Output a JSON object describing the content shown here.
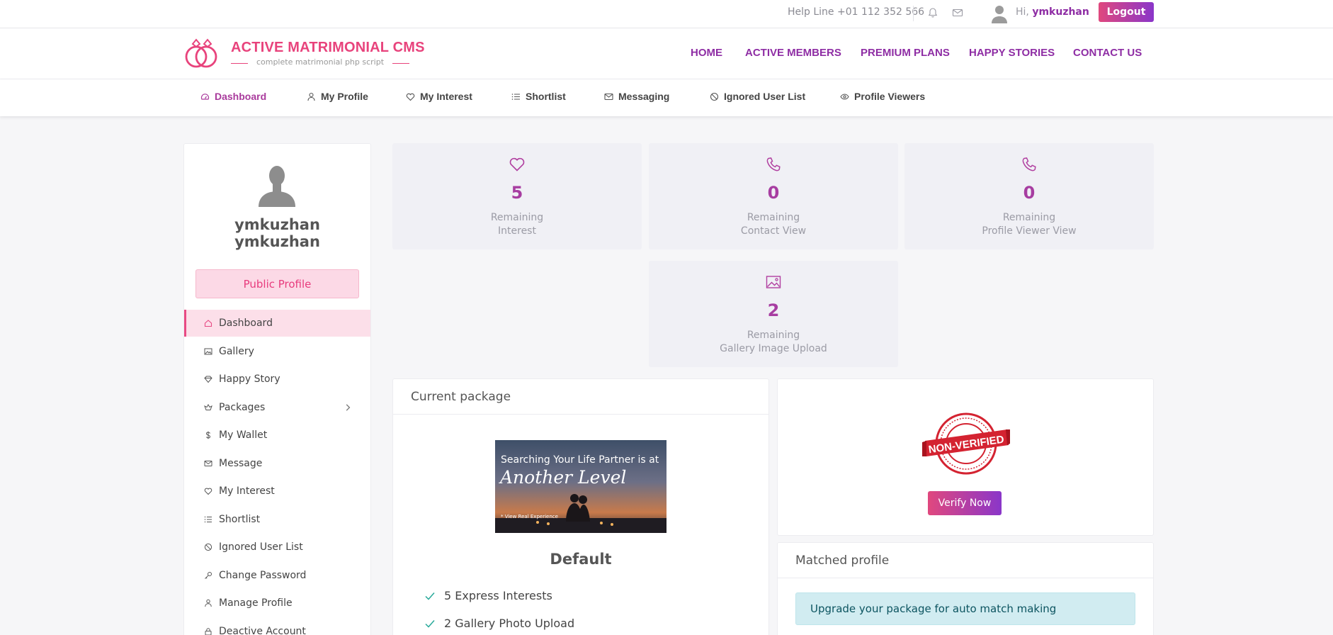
{
  "topbar": {
    "helpline": "Help Line +01 112 352 566",
    "greeting": "Hi,",
    "username": "ymkuzhan",
    "logout_label": "Logout"
  },
  "logo": {
    "title": "ACTIVE MATRIMONIAL CMS",
    "subtitle": "complete matrimonial php script"
  },
  "main_nav": [
    "HOME",
    "ACTIVE MEMBERS",
    "PREMIUM PLANS",
    "HAPPY STORIES",
    "CONTACT US"
  ],
  "sub_nav": [
    {
      "label": "Dashboard",
      "icon": "dashboard-icon"
    },
    {
      "label": "My Profile",
      "icon": "user-icon"
    },
    {
      "label": "My Interest",
      "icon": "heart-icon"
    },
    {
      "label": "Shortlist",
      "icon": "list-icon"
    },
    {
      "label": "Messaging",
      "icon": "mail-icon"
    },
    {
      "label": "Ignored User List",
      "icon": "ban-icon"
    },
    {
      "label": "Profile Viewers",
      "icon": "eye-icon"
    }
  ],
  "profile": {
    "first_name": "ymkuzhan",
    "last_name": "ymkuzhan",
    "public_profile_label": "Public Profile"
  },
  "sidebar": {
    "items": [
      {
        "label": "Dashboard",
        "icon": "home-icon"
      },
      {
        "label": "Gallery",
        "icon": "image-icon"
      },
      {
        "label": "Happy Story",
        "icon": "diamond-icon"
      },
      {
        "label": "Packages",
        "icon": "package-icon"
      },
      {
        "label": "My Wallet",
        "icon": "dollar-icon"
      },
      {
        "label": "Message",
        "icon": "mail-icon"
      },
      {
        "label": "My Interest",
        "icon": "heart-icon"
      },
      {
        "label": "Shortlist",
        "icon": "list-icon"
      },
      {
        "label": "Ignored User List",
        "icon": "ban-icon"
      },
      {
        "label": "Change Password",
        "icon": "key-icon"
      },
      {
        "label": "Manage Profile",
        "icon": "user-icon"
      },
      {
        "label": "Deactive Account",
        "icon": "lock-icon"
      }
    ]
  },
  "stats": [
    {
      "value": "5",
      "label_line1": "Remaining",
      "label_line2": "Interest",
      "icon": "heart-icon"
    },
    {
      "value": "0",
      "label_line1": "Remaining",
      "label_line2": "Contact View",
      "icon": "phone-icon"
    },
    {
      "value": "0",
      "label_line1": "Remaining",
      "label_line2": "Profile Viewer View",
      "icon": "phone-icon"
    },
    {
      "value": "2",
      "label_line1": "Remaining",
      "label_line2": "Gallery Image Upload",
      "icon": "image-icon"
    }
  ],
  "current_package": {
    "heading": "Current package",
    "banner_line1": "Searching Your Life Partner is at",
    "banner_line2": "Another Level",
    "banner_line3": "* View Real Experience",
    "name": "Default",
    "features": [
      "5 Express Interests",
      "2 Gallery Photo Upload"
    ]
  },
  "verification": {
    "stamp_text": "NON-VERIFIED",
    "verify_label": "Verify Now"
  },
  "matched_profile": {
    "heading": "Matched profile",
    "alert": "Upgrade your package for auto match making"
  },
  "colors": {
    "brand_pink": "#e8437c",
    "brand_purple": "#8e2da4",
    "stat_value": "#a73da1",
    "stamp_red": "#d42331",
    "check_green": "#28a99a"
  }
}
